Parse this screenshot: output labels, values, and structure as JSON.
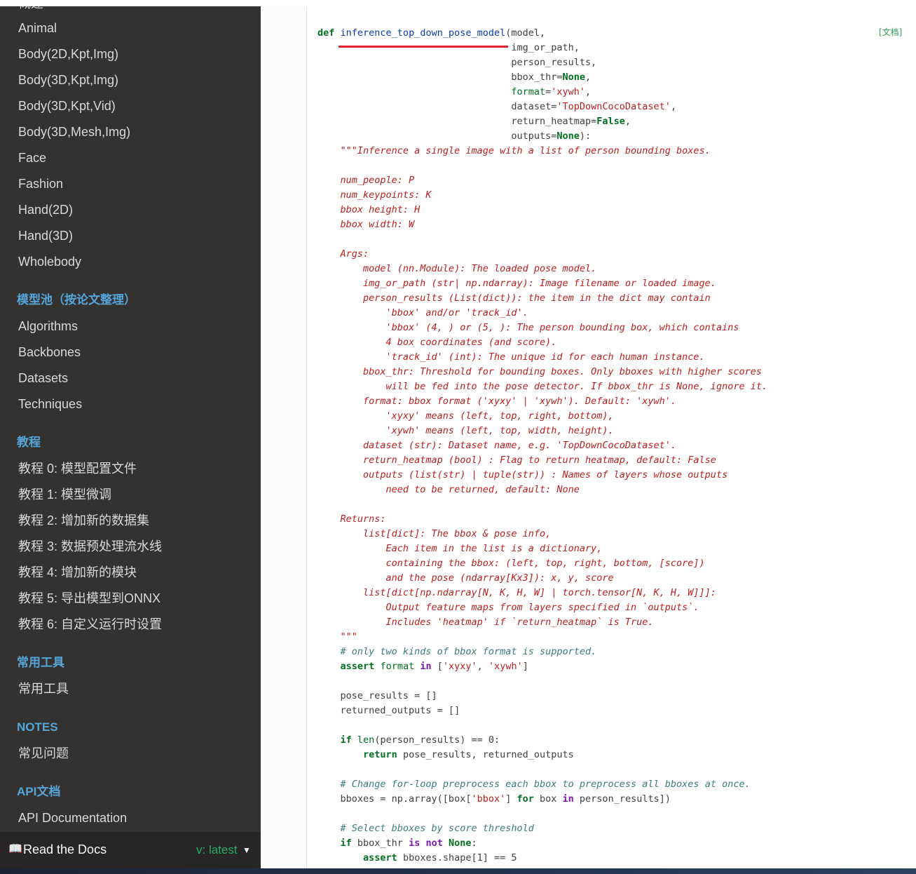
{
  "sidebar": {
    "clipped_top_label": "概述",
    "section1_items": [
      "Animal",
      "Body(2D,Kpt,Img)",
      "Body(3D,Kpt,Img)",
      "Body(3D,Kpt,Vid)",
      "Body(3D,Mesh,Img)",
      "Face",
      "Fashion",
      "Hand(2D)",
      "Hand(3D)",
      "Wholebody"
    ],
    "caption_model_zoo": "模型池（按论文整理）",
    "model_zoo_items": [
      "Algorithms",
      "Backbones",
      "Datasets",
      "Techniques"
    ],
    "caption_tutorials": "教程",
    "tutorial_items": [
      "教程 0: 模型配置文件",
      "教程 1: 模型微调",
      "教程 2: 增加新的数据集",
      "教程 3: 数据预处理流水线",
      "教程 4: 增加新的模块",
      "教程 5: 导出模型到ONNX",
      "教程 6: 自定义运行时设置"
    ],
    "caption_tools": "常用工具",
    "tools_items": [
      "常用工具"
    ],
    "caption_notes": "NOTES",
    "notes_items": [
      "常见问题"
    ],
    "caption_api": "API文档",
    "api_items": [
      "API Documentation"
    ]
  },
  "rtd": {
    "icon": "book-icon",
    "label": "Read the Docs",
    "version": "v: latest"
  },
  "source_link": "[文档]",
  "function_name": "inference_top_down_pose_model",
  "colors": {
    "sidebar_bg": "#343131",
    "caption": "#55a5d9",
    "highlight_underline": "#e5222d",
    "keyword": "#007020",
    "string": "#ba2121"
  }
}
